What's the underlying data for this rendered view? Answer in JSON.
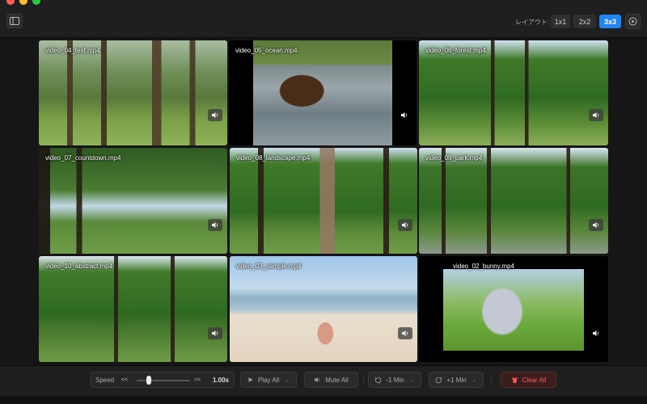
{
  "window": {
    "layout_label": "レイアウト:",
    "layout_options": [
      "1x1",
      "2x2",
      "3x3"
    ],
    "active_layout": "3x3"
  },
  "videos": [
    {
      "label": "video_04_test.mp4"
    },
    {
      "label": "video_05_ocean.mp4"
    },
    {
      "label": "video_06_forest.mp4"
    },
    {
      "label": "video_07_countdown.mp4"
    },
    {
      "label": "video_08_landscape.mp4"
    },
    {
      "label": "video_09_park.mp4"
    },
    {
      "label": "video_10_abstract.mp4"
    },
    {
      "label": "video_03_sample.mp4"
    },
    {
      "label": "video_02_bunny.mp4"
    }
  ],
  "controls": {
    "speed_label": "Speed",
    "speed_down": "<<",
    "speed_up": ">>",
    "speed_value": "1.00x",
    "speed_fraction": 0.2,
    "play_all": "Play All",
    "mute_all": "Mute All",
    "minus_min": "-1 Min",
    "plus_min": "+1 Min",
    "clear_all": "Clear All"
  },
  "colors": {
    "accent": "#2185f0",
    "danger": "#ff5a5a"
  },
  "icons": {
    "sidebar": "sidebar-toggle-icon",
    "settings": "play-circle-icon",
    "volume": "speaker-icon",
    "play": "play-icon",
    "rewind": "rotate-ccw-icon",
    "forward": "rotate-cw-icon",
    "trash": "trash-icon"
  }
}
